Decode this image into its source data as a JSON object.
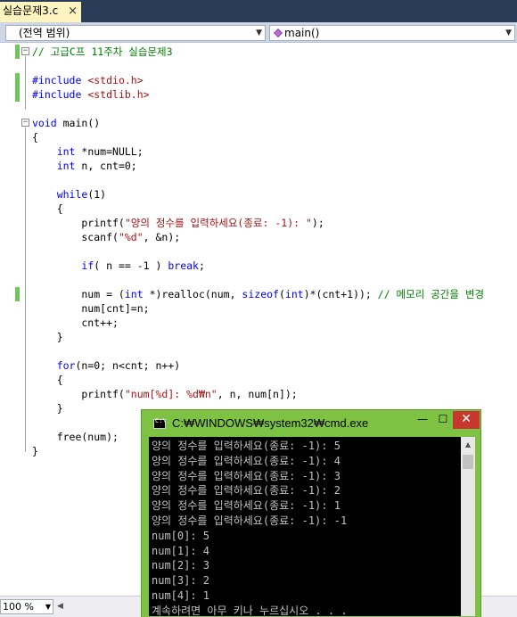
{
  "tab": {
    "title": "실습문제3.c",
    "close": "×"
  },
  "navbar": {
    "scope": "(전역 범위)",
    "member": "main()"
  },
  "editor": {
    "lines": [
      "// 고급C프 11주차 실습문제3",
      "",
      "#include <stdio.h>",
      "#include <stdlib.h>",
      "",
      "void main()",
      "{",
      "    int *num=NULL;",
      "    int n, cnt=0;",
      "",
      "    while(1)",
      "    {",
      "        printf(\"양의 정수를 입력하세요(종료: -1): \");",
      "        scanf(\"%d\", &n);",
      "",
      "        if( n == -1 ) break;",
      "",
      "        num = (int *)realloc(num, sizeof(int)*(cnt+1)); // 메모리 공간을 변경",
      "        num[cnt]=n;",
      "        cnt++;",
      "    }",
      "",
      "    for(n=0; n<cnt; n++)",
      "    {",
      "        printf(\"num[%d]: %d₩n\", n, num[n]);",
      "    }",
      "",
      "    free(num);",
      "}"
    ]
  },
  "statusbar": {
    "zoom": "100 %"
  },
  "cmd": {
    "title": "C:₩WINDOWS₩system32₩cmd.exe",
    "minimize": "—",
    "maximize": "☐",
    "close": "✕",
    "lines": [
      "양의 정수를 입력하세요(종료: -1): 5",
      "양의 정수를 입력하세요(종료: -1): 4",
      "양의 정수를 입력하세요(종료: -1): 3",
      "양의 정수를 입력하세요(종료: -1): 2",
      "양의 정수를 입력하세요(종료: -1): 1",
      "양의 정수를 입력하세요(종료: -1): -1",
      "num[0]: 5",
      "num[1]: 4",
      "num[2]: 3",
      "num[3]: 2",
      "num[4]: 1",
      "계속하려면 아무 키나 누르십시오 . . ."
    ]
  },
  "colors": {
    "tab_background": "#fdf4bf",
    "keyword": "#0000ff",
    "string": "#a31515",
    "comment": "#008000",
    "change_marker": "#6bc75a",
    "cmd_frame": "#7dc242",
    "close_button": "#c7372f"
  },
  "icons": [
    "close-icon",
    "function-icon",
    "dropdown-arrow-icon",
    "cmd-icon",
    "minimize-icon",
    "maximize-icon",
    "window-close-icon"
  ]
}
